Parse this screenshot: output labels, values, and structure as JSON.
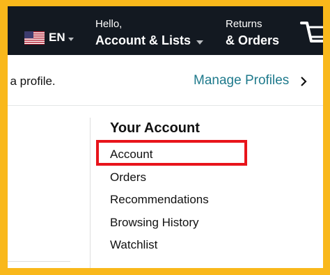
{
  "navbar": {
    "language": "EN",
    "flag_icon": "us-flag-icon",
    "greeting": "Hello,",
    "account_lists": "Account & Lists",
    "returns": "Returns",
    "orders": "& Orders",
    "cart_icon": "cart-icon",
    "background_color": "#131921"
  },
  "profile_bar": {
    "prompt_text": "t a profile.",
    "manage_link": "Manage Profiles"
  },
  "account_menu": {
    "heading": "Your Account",
    "items": [
      {
        "label": "Account"
      },
      {
        "label": "Orders"
      },
      {
        "label": "Recommendations"
      },
      {
        "label": "Browsing History"
      },
      {
        "label": "Watchlist"
      }
    ]
  },
  "colors": {
    "outer_border": "#f9b81b",
    "link": "#1f7a8c",
    "highlight": "#e8141b"
  }
}
